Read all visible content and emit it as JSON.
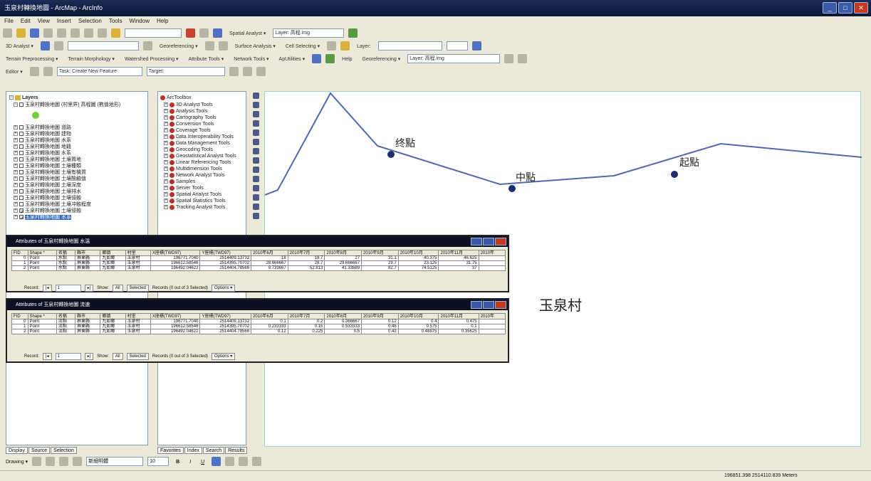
{
  "window": {
    "title": "玉泉村轉換地圖 - ArcMap - ArcInfo"
  },
  "menu": [
    "File",
    "Edit",
    "View",
    "Insert",
    "Selection",
    "Tools",
    "Window",
    "Help"
  ],
  "toolbar1": {
    "items": [
      "Spatial Analyst ▾",
      "Layer: 高程.img"
    ]
  },
  "toolbar2": {
    "items": [
      "3D Analyst ▾",
      "Georeferencing ▾",
      "Surface Analysis ▾",
      "Cell Selecting ▾",
      "Layer:"
    ]
  },
  "toolbar3": {
    "items": [
      "Terrain Preprocessing ▾",
      "Terrain Morphology ▾",
      "Watershed Processing ▾",
      "Attribute Tools ▾",
      "Network Tools ▾",
      "ApUtilities ▾",
      "Help",
      "Georeferencing ▾",
      "Layer: 高程.img"
    ]
  },
  "toolbar4": {
    "items": [
      "Editor ▾",
      "Task: Create New Feature",
      "Target:"
    ]
  },
  "toc": {
    "root": "Layers",
    "items": [
      "玉泉村轉換地圖 (村里界) 高程圖 (數值地形)",
      "玉泉村轉換地圖 道路",
      "玉泉村轉換地圖 建物",
      "玉泉村轉換地圖 水系",
      "玉泉村轉換地圖 地籍",
      "玉泉村轉換地圖 水系",
      "玉泉村轉換地圖 土壤質地",
      "玉泉村轉換地圖 土壤種類",
      "玉泉村轉換地圖 土壤有機質",
      "玉泉村轉換地圖 土壤酸鹼值",
      "玉泉村轉換地圖 土壤深度",
      "玉泉村轉換地圖 土壤排水",
      "玉泉村轉換地圖 土壤侵蝕",
      "玉泉村轉換地圖 土壤冲蝕程度",
      "玉泉村轉換地圖 土壤侵蝕",
      "玉泉村轉換地圖 水系"
    ],
    "tabs": [
      "Display",
      "Source",
      "Selection"
    ]
  },
  "toolbox": {
    "root": "ArcToolbox",
    "items": [
      "3D Analyst Tools",
      "Analysis Tools",
      "Cartography Tools",
      "Conversion Tools",
      "Coverage Tools",
      "Data Interoperability Tools",
      "Data Management Tools",
      "Geocoding Tools",
      "Geostatistical Analyst Tools",
      "Linear Referencing Tools",
      "Multidimension Tools",
      "Network Analyst Tools",
      "Samples",
      "Server Tools",
      "Spatial Analyst Tools",
      "Spatial Statistics Tools",
      "Tracking Analyst Tools"
    ],
    "tabs": [
      "Favorites",
      "Index",
      "Search",
      "Results"
    ]
  },
  "map": {
    "labels": {
      "end": "终點",
      "mid": "中點",
      "start": "起點",
      "village": "玉泉村"
    },
    "colors": {
      "line": "#5068b0",
      "point": "#1f2c6e"
    }
  },
  "attr1": {
    "title": "Attributes of 玉泉村轉換地圖 水溫",
    "columns": [
      "FID",
      "Shape *",
      "名稱",
      "縣市",
      "鄉鎮",
      "村里",
      "X座標(TWD97)",
      "Y座標(TWD97)",
      "2010年6月",
      "2010年7月",
      "2010年8月",
      "2010年9月",
      "2010年10月",
      "2010年11月",
      "2010年"
    ],
    "rows": [
      [
        "0",
        "Point",
        "水點",
        "屏東縣",
        "九如鄉",
        "玉泉村",
        "196771.7040",
        "2514409.13732",
        "18",
        "18.7",
        "27",
        "31.1",
        "40.375",
        "46.625"
      ],
      [
        "1",
        "Point",
        "水點",
        "屏東縣",
        "九如鄉",
        "玉泉村",
        "196612.58546",
        "2514395.70702",
        "28.666667",
        "28.7",
        "29.666667",
        "29.7",
        "23.125",
        "31.75"
      ],
      [
        "2",
        "Point",
        "水點",
        "屏東縣",
        "九如鄉",
        "玉泉村",
        "196492.04622",
        "2514404.78566",
        "9.733667",
        "52.813",
        "41.33889",
        "82.7",
        "74.5125",
        "37"
      ]
    ],
    "nav": {
      "record": "Record:",
      "value": "1",
      "show": "Show:",
      "all": "All",
      "selected": "Selected",
      "records": "Records (0 out of 3 Selected)",
      "options": "Options ▾"
    }
  },
  "attr2": {
    "title": "Attributes of 玉泉村轉換地圖 流速",
    "columns": [
      "FID",
      "Shape *",
      "名稱",
      "縣市",
      "鄉鎮",
      "村里",
      "X座標(TWD97)",
      "Y座標(TWD97)",
      "2010年6月",
      "2010年7月",
      "2010年8月",
      "2010年9月",
      "2010年10月",
      "2010年11月",
      "2010年"
    ],
    "rows": [
      [
        "0",
        "Point",
        "流點",
        "屏東縣",
        "九如鄉",
        "玉泉村",
        "196771.7040",
        "2514409.13732",
        "0.1",
        "0.2",
        "0.366667",
        "0.12",
        "0.4",
        "0.475"
      ],
      [
        "1",
        "Point",
        "流點",
        "屏東縣",
        "九如鄉",
        "玉泉村",
        "196612.58546",
        "2514395.70702",
        "0.233333",
        "0.15",
        "0.533333",
        "0.46",
        "0.575",
        "0.1"
      ],
      [
        "2",
        "Point",
        "流點",
        "屏東縣",
        "九如鄉",
        "玉泉村",
        "196492.04622",
        "2514404.78566",
        "0.12",
        "0.225",
        "0.5",
        "0.42",
        "0.48875",
        "0.35625"
      ]
    ],
    "nav": {
      "record": "Record:",
      "value": "1",
      "show": "Show:",
      "all": "All",
      "selected": "Selected",
      "records": "Records (0 out of 3 Selected)",
      "options": "Options ▾"
    }
  },
  "drawing": {
    "label": "Drawing ▾",
    "font": "新細明體",
    "size": "10"
  },
  "status": {
    "coords": "196851.398  2514110.839 Meters"
  }
}
